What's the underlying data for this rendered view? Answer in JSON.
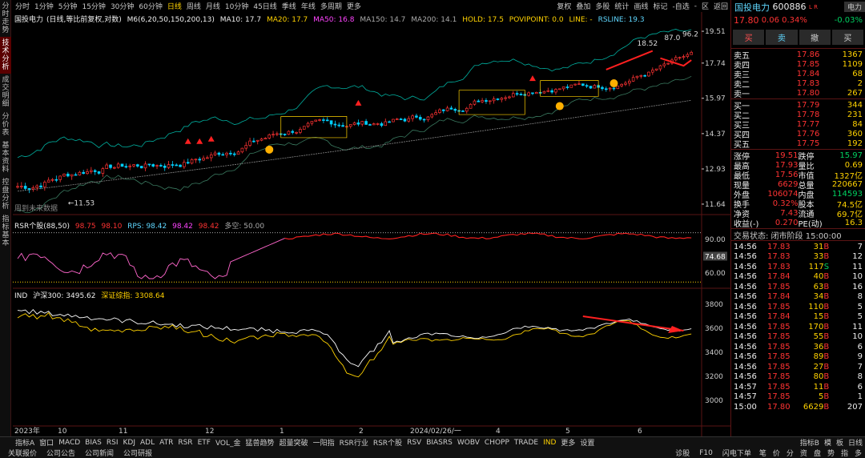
{
  "left_tabs": [
    "分时走势",
    "技术分析",
    "成交明细",
    "分价表",
    "基本资料",
    "控盘分析",
    "指标基本"
  ],
  "periods": [
    "分时",
    "1分钟",
    "5分钟",
    "15分钟",
    "30分钟",
    "60分钟",
    "日线",
    "周线",
    "月线",
    "10分钟",
    "45日线",
    "季线",
    "年线",
    "多周期",
    "更多"
  ],
  "active_period": "日线",
  "tools": [
    "复权",
    "叠加",
    "多股",
    "统计",
    "画线",
    "标记",
    "-自选",
    "-",
    "区",
    "返回"
  ],
  "main": {
    "stock": "国投电力",
    "mode": "(日线,等比前复权,对数)",
    "ind": "M6(6,20,50,150,200,13)",
    "ma10": "MA10: 17.7",
    "ma20": "MA20: 17.7",
    "ma50": "MA50: 16.8",
    "ma150": "MA150: 14.7",
    "ma200": "MA200: 14.1",
    "hold": "HOLD: 17.5",
    "pivot": "POVIPOINT: 0.0",
    "line": "LINE: -",
    "rsline": "RSLINE: 19.3",
    "yaxis": [
      "19.51",
      "17.74",
      "15.97",
      "14.37",
      "12.93",
      "11.64"
    ],
    "low_label": "←11.53",
    "hi_label": "18.52",
    "peak_label": "87.0",
    "pct_label": "96.2",
    "notice": "周到未来数据"
  },
  "rsr": {
    "title": "RSR个股(88,50)",
    "v1": "98.75",
    "v2": "98.10",
    "rps_lbl": "RPS: 98.42",
    "v3": "98.42",
    "v4": "98.42",
    "dk": "多空: 50.00",
    "yaxis": [
      "90.00",
      "60.00"
    ],
    "current": "74.68"
  },
  "ind": {
    "title": "IND",
    "hs300": "沪深300: 3495.62",
    "szzz": "深证综指: 3308.64",
    "yaxis": [
      "3800",
      "3600",
      "3400",
      "3200",
      "3000"
    ]
  },
  "xaxis": {
    "labels": [
      "2023年",
      "10",
      "11",
      "12",
      "1",
      "2",
      "2024/02/26/一",
      "4",
      "5",
      "6"
    ]
  },
  "quote": {
    "name": "国投电力",
    "code": "600886",
    "tag": "L R",
    "sector": "电力",
    "sector_chg": "-0.03%",
    "price": "17.80",
    "change": "0.06",
    "pct": "0.34%",
    "btns": [
      "买",
      "卖",
      "撤",
      "买"
    ]
  },
  "sell": [
    {
      "l": "卖五",
      "p": "17.86",
      "v": "1367"
    },
    {
      "l": "卖四",
      "p": "17.85",
      "v": "1109"
    },
    {
      "l": "卖三",
      "p": "17.84",
      "v": "68"
    },
    {
      "l": "卖二",
      "p": "17.83",
      "v": "2"
    },
    {
      "l": "卖一",
      "p": "17.80",
      "v": "267"
    }
  ],
  "buy": [
    {
      "l": "买一",
      "p": "17.79",
      "v": "344"
    },
    {
      "l": "买二",
      "p": "17.78",
      "v": "231"
    },
    {
      "l": "买三",
      "p": "17.77",
      "v": "84"
    },
    {
      "l": "买四",
      "p": "17.76",
      "v": "360"
    },
    {
      "l": "买五",
      "p": "17.75",
      "v": "192"
    }
  ],
  "stats": [
    [
      "涨停",
      "19.51",
      "跌停",
      "15.97"
    ],
    [
      "最高",
      "17.93",
      "量比",
      "0.69"
    ],
    [
      "最低",
      "17.56",
      "市值",
      "1327亿"
    ],
    [
      "现量",
      "6629",
      "总量",
      "220667"
    ],
    [
      "外盘",
      "106074",
      "内盘",
      "114593"
    ],
    [
      "换手",
      "0.32%",
      "股本",
      "74.5亿"
    ],
    [
      "净资",
      "7.43",
      "流通",
      "69.7亿"
    ],
    [
      "收益(-)",
      "0.270",
      "PE(动)",
      "16.3"
    ]
  ],
  "trade_status": "交易状态: 闭市阶段 15:00:00",
  "ticks": [
    [
      "14:56",
      "17.83",
      "31",
      "B",
      "7"
    ],
    [
      "14:56",
      "17.83",
      "33",
      "B",
      "12"
    ],
    [
      "14:56",
      "17.83",
      "117",
      "S",
      "11"
    ],
    [
      "14:56",
      "17.84",
      "40",
      "B",
      "10"
    ],
    [
      "14:56",
      "17.85",
      "63",
      "B",
      "16"
    ],
    [
      "14:56",
      "17.84",
      "34",
      "B",
      "8"
    ],
    [
      "14:56",
      "17.85",
      "110",
      "B",
      "5"
    ],
    [
      "14:56",
      "17.84",
      "15",
      "B",
      "5"
    ],
    [
      "14:56",
      "17.85",
      "170",
      "B",
      "11"
    ],
    [
      "14:56",
      "17.85",
      "55",
      "B",
      "10"
    ],
    [
      "14:56",
      "17.85",
      "36",
      "B",
      "6"
    ],
    [
      "14:56",
      "17.85",
      "89",
      "B",
      "9"
    ],
    [
      "14:56",
      "17.85",
      "27",
      "B",
      "7"
    ],
    [
      "14:56",
      "17.85",
      "80",
      "B",
      "8"
    ],
    [
      "14:57",
      "17.85",
      "11",
      "B",
      "6"
    ],
    [
      "14:57",
      "17.85",
      "5",
      "B",
      "1"
    ],
    [
      "15:00",
      "17.80",
      "6629",
      "B",
      "207"
    ]
  ],
  "bottom_tabs": [
    "指标A",
    "窗口",
    "MACD",
    "BIAS",
    "RSI",
    "KDJ",
    "ADL",
    "ATR",
    "RSR",
    "ETF",
    "VOL_金",
    "猛兽趋势",
    "超量突破",
    "一阳指",
    "RSR行业",
    "RSR个股",
    "RSV",
    "BIASRS",
    "WOBV",
    "CHOPP",
    "TRADE",
    "IND",
    "更多",
    "设置"
  ],
  "active_bottom_tab": "IND",
  "bottom_right": [
    "指标B",
    "模",
    "板",
    "日线"
  ],
  "bottom_links": [
    "关联报价",
    "公司公告",
    "公司新闻",
    "公司研报"
  ],
  "bottom_right2": [
    "诊股",
    "F10",
    "闪电下单"
  ],
  "right_tabs": [
    "笔",
    "价",
    "分",
    "资",
    "盘",
    "势",
    "指",
    "多"
  ],
  "colors": {
    "up": "#ff3333",
    "down": "#00d0ff",
    "ma10": "#ffffff",
    "ma20": "#ffd200",
    "ma50": "#ff44ff",
    "ma150": "#aaaaaa",
    "ma200": "#00b0a0"
  }
}
